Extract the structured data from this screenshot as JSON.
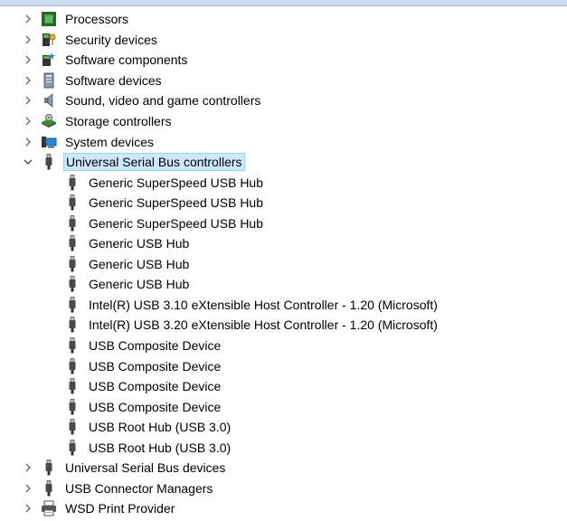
{
  "tree": {
    "categories_before": [
      {
        "label": "Processors",
        "icon": "processor-icon"
      },
      {
        "label": "Security devices",
        "icon": "security-key-icon"
      },
      {
        "label": "Software components",
        "icon": "software-component-icon"
      },
      {
        "label": "Software devices",
        "icon": "software-device-icon"
      },
      {
        "label": "Sound, video and game controllers",
        "icon": "speaker-icon"
      },
      {
        "label": "Storage controllers",
        "icon": "storage-controller-icon"
      },
      {
        "label": "System devices",
        "icon": "system-device-icon"
      }
    ],
    "expanded": {
      "label": "Universal Serial Bus controllers",
      "icon": "usb-plug-icon",
      "children": [
        "Generic SuperSpeed USB Hub",
        "Generic SuperSpeed USB Hub",
        "Generic SuperSpeed USB Hub",
        "Generic USB Hub",
        "Generic USB Hub",
        "Generic USB Hub",
        "Intel(R) USB 3.10 eXtensible Host Controller - 1.20 (Microsoft)",
        "Intel(R) USB 3.20 eXtensible Host Controller - 1.20 (Microsoft)",
        "USB Composite Device",
        "USB Composite Device",
        "USB Composite Device",
        "USB Composite Device",
        "USB Root Hub (USB 3.0)",
        "USB Root Hub (USB 3.0)"
      ]
    },
    "categories_after": [
      {
        "label": "Universal Serial Bus devices",
        "icon": "usb-plug-icon"
      },
      {
        "label": "USB Connector Managers",
        "icon": "usb-plug-icon"
      },
      {
        "label": "WSD Print Provider",
        "icon": "printer-icon"
      }
    ]
  },
  "colors": {
    "selection_bg": "#cce8ff",
    "selection_border": "#99d1ff"
  }
}
